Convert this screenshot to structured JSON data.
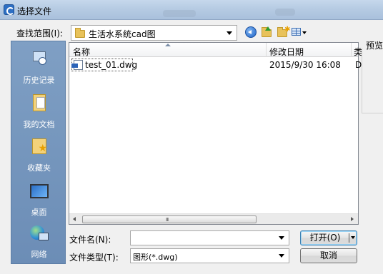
{
  "window": {
    "title": "选择文件"
  },
  "lookin": {
    "label": "查找范围(I):",
    "value": "生活水系统cad图"
  },
  "places": [
    {
      "label": "历史记录",
      "icon": "history-icon"
    },
    {
      "label": "我的文档",
      "icon": "my-documents-icon"
    },
    {
      "label": "收藏夹",
      "icon": "favorites-icon"
    },
    {
      "label": "桌面",
      "icon": "desktop-icon"
    },
    {
      "label": "网络",
      "icon": "network-icon"
    }
  ],
  "filelist": {
    "columns": [
      "名称",
      "修改日期",
      "类"
    ],
    "rows": [
      {
        "name": "test_01.dwg",
        "date": "2015/9/30 16:08",
        "extra": "D"
      }
    ],
    "scroll_grip": "III"
  },
  "preview": {
    "label": "预览"
  },
  "filename": {
    "label": "文件名(N):",
    "value": ""
  },
  "filetype": {
    "label": "文件类型(T):",
    "value": "图形(*.dwg)"
  },
  "buttons": {
    "open": "打开(O)",
    "cancel": "取消"
  }
}
